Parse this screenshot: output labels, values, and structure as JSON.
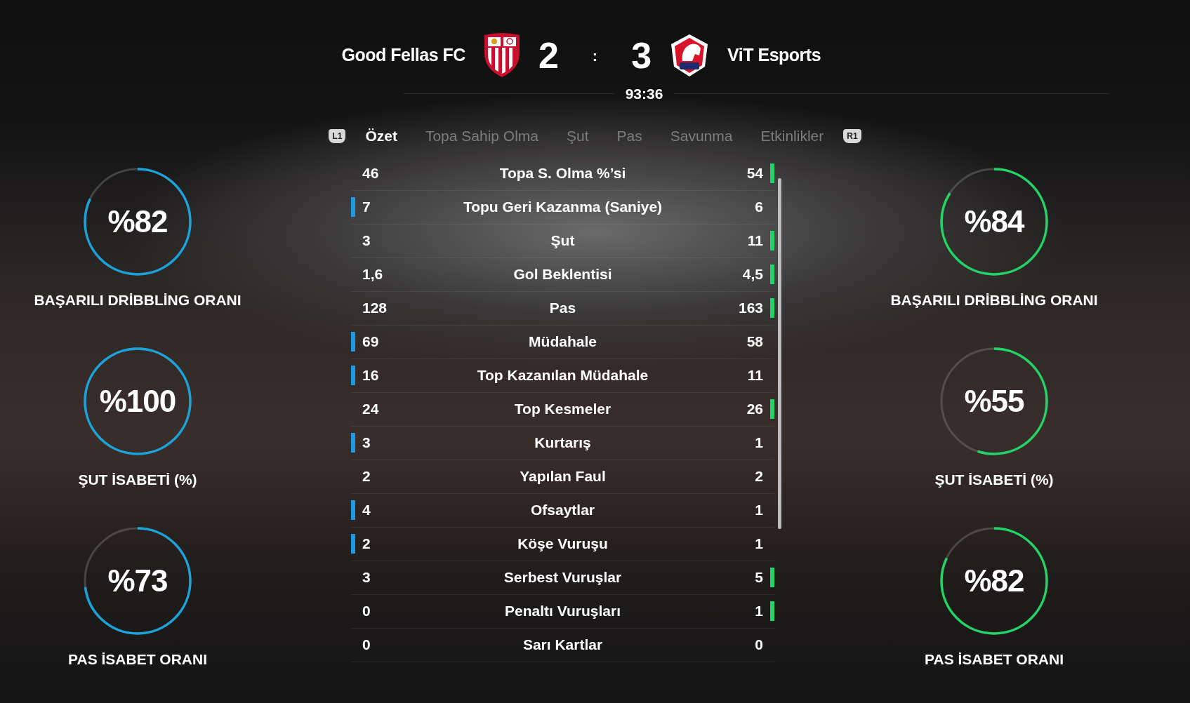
{
  "match": {
    "home_team": "Good Fellas FC",
    "home_score": "2",
    "separator": ":",
    "away_score": "3",
    "away_team": "ViT Esports",
    "clock": "93:36"
  },
  "tabs": {
    "prev_key": "L1",
    "next_key": "R1",
    "items": [
      {
        "label": "Özet",
        "selected": true
      },
      {
        "label": "Topa Sahip Olma",
        "selected": false
      },
      {
        "label": "Şut",
        "selected": false
      },
      {
        "label": "Pas",
        "selected": false
      },
      {
        "label": "Savunma",
        "selected": false
      },
      {
        "label": "Etkinlikler",
        "selected": false
      }
    ]
  },
  "home_gauges": [
    {
      "value": "%82",
      "level": 0.82,
      "label": "BAŞARILI DRİBBLİNG ORANI"
    },
    {
      "value": "%100",
      "level": 1,
      "label": "ŞUT İSABETİ (%)"
    },
    {
      "value": "%73",
      "level": 0.73,
      "label": "PAS İSABET ORANI"
    }
  ],
  "stats": [
    {
      "home": "46",
      "name": "Topa S. Olma %’si",
      "away": "54",
      "home_marked": false,
      "away_marked": true
    },
    {
      "home": "7",
      "name": "Topu Geri Kazanma (Saniye)",
      "away": "6",
      "home_marked": true,
      "away_marked": false
    },
    {
      "home": "3",
      "name": "Şut",
      "away": "11",
      "home_marked": false,
      "away_marked": true
    },
    {
      "home": "1,6",
      "name": "Gol Beklentisi",
      "away": "4,5",
      "home_marked": false,
      "away_marked": true
    },
    {
      "home": "128",
      "name": "Pas",
      "away": "163",
      "home_marked": false,
      "away_marked": true
    },
    {
      "home": "69",
      "name": "Müdahale",
      "away": "58",
      "home_marked": true,
      "away_marked": false
    },
    {
      "home": "16",
      "name": "Top Kazanılan Müdahale",
      "away": "11",
      "home_marked": true,
      "away_marked": false
    },
    {
      "home": "24",
      "name": "Top Kesmeler",
      "away": "26",
      "home_marked": false,
      "away_marked": true
    },
    {
      "home": "3",
      "name": "Kurtarış",
      "away": "1",
      "home_marked": true,
      "away_marked": false
    },
    {
      "home": "2",
      "name": "Yapılan Faul",
      "away": "2",
      "home_marked": false,
      "away_marked": false
    },
    {
      "home": "4",
      "name": "Ofsaytlar",
      "away": "1",
      "home_marked": true,
      "away_marked": false
    },
    {
      "home": "2",
      "name": "Köşe Vuruşu",
      "away": "1",
      "home_marked": true,
      "away_marked": false
    },
    {
      "home": "3",
      "name": "Serbest Vuruşlar",
      "away": "5",
      "home_marked": false,
      "away_marked": true
    },
    {
      "home": "0",
      "name": "Penaltı Vuruşları",
      "away": "1",
      "home_marked": false,
      "away_marked": true
    },
    {
      "home": "0",
      "name": "Sarı Kartlar",
      "away": "0",
      "home_marked": false,
      "away_marked": false
    }
  ],
  "away_gauges": [
    {
      "value": "%84",
      "level": 0.84,
      "label": "BAŞARILI DRİBBLİNG ORANI"
    },
    {
      "value": "%55",
      "level": 0.55,
      "label": "ŞUT İSABETİ (%)"
    },
    {
      "value": "%82",
      "level": 0.82,
      "label": "PAS İSABET ORANI"
    }
  ]
}
